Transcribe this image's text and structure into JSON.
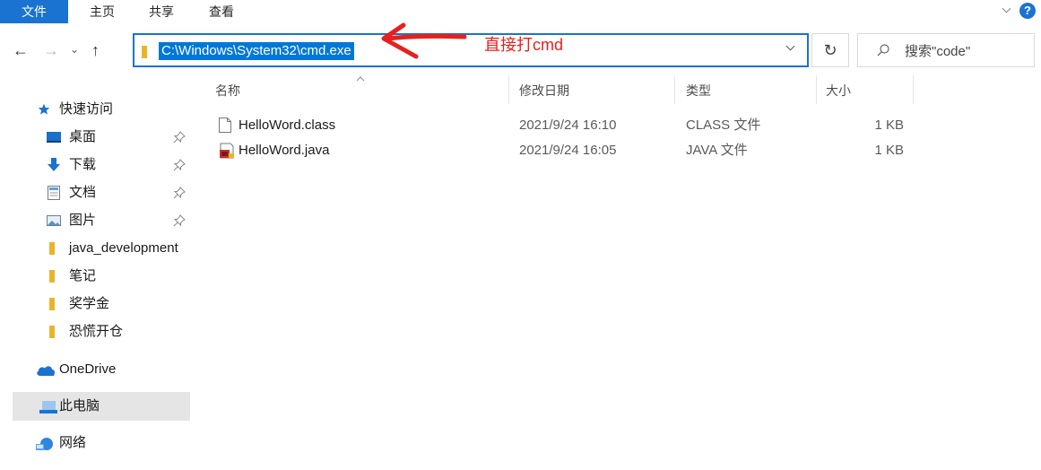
{
  "ribbon": {
    "tabs": [
      "文件",
      "主页",
      "共享",
      "查看"
    ]
  },
  "nav": {
    "back": "←",
    "forward": "→",
    "recent": "⌄",
    "up": "↑"
  },
  "address": {
    "path": "C:\\Windows\\System32\\cmd.exe"
  },
  "refresh_glyph": "↻",
  "search": {
    "placeholder": "搜索\"code\""
  },
  "annotation": {
    "text": "直接打cmd",
    "color": "#e8201d"
  },
  "sidebar": {
    "items": [
      {
        "label": "快速访问",
        "icon": "star-icon"
      },
      {
        "label": "桌面",
        "icon": "desktop-icon",
        "pinned": true
      },
      {
        "label": "下载",
        "icon": "download-icon",
        "pinned": true
      },
      {
        "label": "文档",
        "icon": "document-icon",
        "pinned": true
      },
      {
        "label": "图片",
        "icon": "picture-icon",
        "pinned": true
      },
      {
        "label": "java_development",
        "icon": "folder-icon"
      },
      {
        "label": "笔记",
        "icon": "folder-icon"
      },
      {
        "label": "奖学金",
        "icon": "folder-icon"
      },
      {
        "label": "恐慌开仓",
        "icon": "folder-icon"
      },
      {
        "label": "OneDrive",
        "icon": "cloud-icon"
      },
      {
        "label": "此电脑",
        "icon": "computer-icon",
        "selected": true
      },
      {
        "label": "网络",
        "icon": "network-icon"
      }
    ]
  },
  "columns": {
    "name": "名称",
    "date": "修改日期",
    "type": "类型",
    "size": "大小"
  },
  "files": [
    {
      "name": "HelloWord.class",
      "date": "2021/9/24 16:10",
      "type": "CLASS 文件",
      "size": "1 KB",
      "icon": "generic-file-icon"
    },
    {
      "name": "HelloWord.java",
      "date": "2021/9/24 16:05",
      "type": "JAVA 文件",
      "size": "1 KB",
      "icon": "java-file-icon"
    }
  ],
  "colors": {
    "accent": "#1a73d0",
    "selection": "#0078d7",
    "folder": "#e8b52a"
  }
}
